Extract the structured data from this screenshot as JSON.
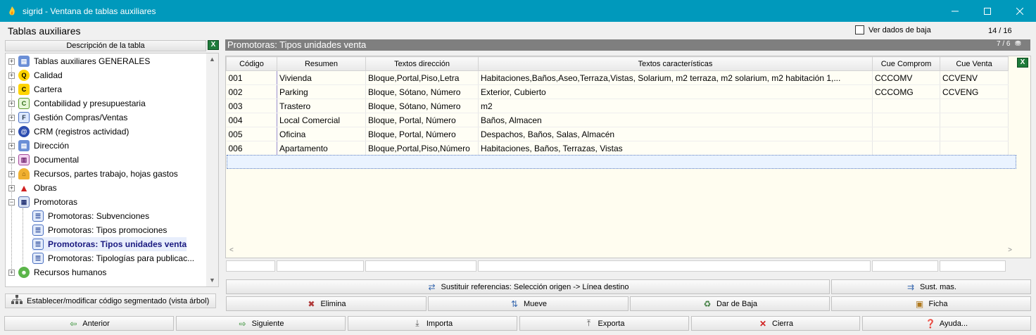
{
  "window": {
    "title": "sigrid - Ventana de tablas auxiliares",
    "minimize_icon": "minimize-icon",
    "maximize_icon": "maximize-icon",
    "close_icon": "close-icon"
  },
  "header": {
    "title": "Tablas auxiliares",
    "ver_dados_baja": "Ver dados de baja",
    "page_count": "14 / 16"
  },
  "tree": {
    "header": "Descripción de la tabla",
    "items": [
      {
        "label": "Tablas auxiliares GENERALES",
        "icon": "tables-icon"
      },
      {
        "label": "Calidad",
        "icon": "quality-icon"
      },
      {
        "label": "Cartera",
        "icon": "portfolio-icon"
      },
      {
        "label": "Contabilidad y presupuestaria",
        "icon": "accounting-icon"
      },
      {
        "label": "Gestión Compras/Ventas",
        "icon": "purchase-sales-icon"
      },
      {
        "label": "CRM (registros actividad)",
        "icon": "crm-icon"
      },
      {
        "label": "Dirección",
        "icon": "management-icon"
      },
      {
        "label": "Documental",
        "icon": "document-icon"
      },
      {
        "label": "Recursos, partes trabajo, hojas gastos",
        "icon": "resources-icon"
      },
      {
        "label": "Obras",
        "icon": "works-icon"
      },
      {
        "label": "Promotoras",
        "icon": "building-icon"
      },
      {
        "label": "Promotoras: Subvenciones",
        "icon": "table-icon"
      },
      {
        "label": "Promotoras: Tipos promociones",
        "icon": "table-icon"
      },
      {
        "label": "Promotoras: Tipos unidades venta",
        "icon": "table-icon"
      },
      {
        "label": "Promotoras: Tipologías para publicac...",
        "icon": "table-icon"
      },
      {
        "label": "Recursos humanos",
        "icon": "people-icon"
      }
    ],
    "segment_button": "Establecer/modificar código segmentado (vista árbol)"
  },
  "grid": {
    "title": "Promotoras: Tipos unidades venta",
    "sub_count": "7 / 6",
    "columns": [
      "Código",
      "Resumen",
      "Textos dirección",
      "Textos características",
      "Cue Comprom",
      "Cue Venta"
    ],
    "rows": [
      [
        "001",
        "Vivienda",
        "Bloque,Portal,Piso,Letra",
        "Habitaciones,Baños,Aseo,Terraza,Vistas, Solarium, m2 terraza, m2 solarium, m2 habitación 1,...",
        "CCCOMV",
        "CCVENV"
      ],
      [
        "002",
        "Parking",
        "Bloque, Sótano, Número",
        "Exterior, Cubierto",
        "CCCOMG",
        "CCVENG"
      ],
      [
        "003",
        "Trastero",
        "Bloque, Sótano, Número",
        "m2",
        "",
        ""
      ],
      [
        "004",
        "Local Comercial",
        "Bloque, Portal, Número",
        "Baños, Almacen",
        "",
        ""
      ],
      [
        "005",
        "Oficina",
        "Bloque, Portal, Número",
        "Despachos, Baños, Salas, Almacén",
        "",
        ""
      ],
      [
        "006",
        "Apartamento",
        "Bloque,Portal,Piso,Número",
        "Habitaciones, Baños, Terrazas, Vistas",
        "",
        ""
      ]
    ]
  },
  "actions": {
    "sustituir": "Sustituir referencias: Selección origen -> Línea destino",
    "sust_mas": "Sust. mas.",
    "elimina": "Elimina",
    "mueve": "Mueve",
    "dar_de_baja": "Dar de Baja",
    "ficha": "Ficha",
    "anterior": "Anterior",
    "siguiente": "Siguiente",
    "importa": "Importa",
    "exporta": "Exporta",
    "cierra": "Cierra",
    "ayuda": "Ayuda..."
  }
}
